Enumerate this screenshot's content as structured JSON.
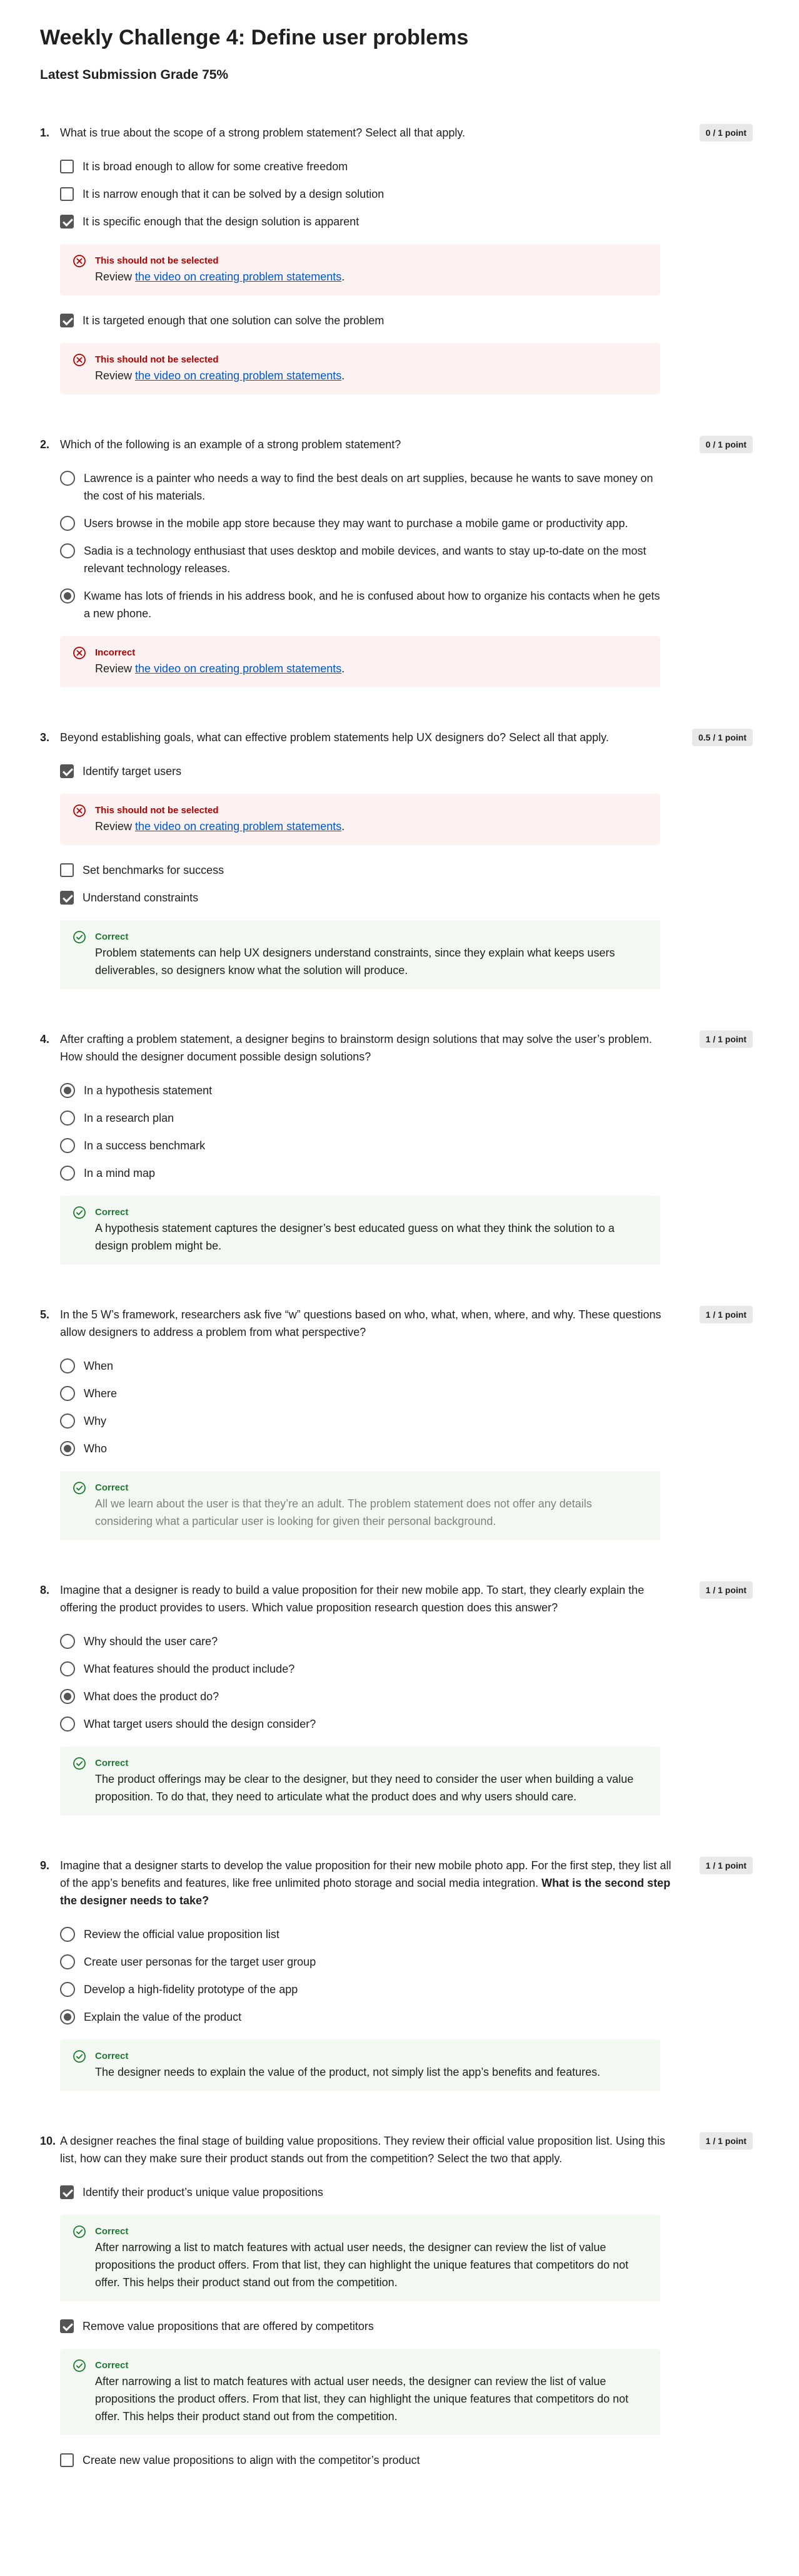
{
  "page": {
    "title": "Weekly Challenge 4: Define user problems",
    "grade": "Latest Submission Grade 75%"
  },
  "feedback_common": {
    "review_prefix": "Review ",
    "review_link": "the video on creating problem statements",
    "review_suffix": "."
  },
  "questions": [
    {
      "number": "1.",
      "text": "What is true about the scope of a strong problem statement? Select all that apply.",
      "points": "0 / 1 point",
      "type": "checkbox",
      "options": [
        {
          "label": "It is broad enough to allow for some creative freedom",
          "checked": false
        },
        {
          "label": "It is narrow enough that it can be solved by a design solution",
          "checked": false
        },
        {
          "label": "It is specific enough that the design solution is apparent",
          "checked": true,
          "feedback": {
            "status": "This should not be selected",
            "kind": "wrong"
          }
        },
        {
          "label": "It is targeted enough that one solution can solve the problem",
          "checked": true,
          "feedback": {
            "status": "This should not be selected",
            "kind": "wrong"
          }
        }
      ]
    },
    {
      "number": "2.",
      "text": "Which of the following is an example of a strong problem statement?",
      "points": "0 / 1 point",
      "type": "radio",
      "options": [
        {
          "label": "Lawrence is a painter who needs a way to find the best deals on art supplies, because he wants to save money on the cost of his materials.",
          "checked": false
        },
        {
          "label": "Users browse in the mobile app store because they may want to purchase a mobile game or productivity app.",
          "checked": false
        },
        {
          "label": "Sadia is a technology enthusiast that uses desktop and mobile devices, and wants to stay up-to-date on the most relevant technology releases.",
          "checked": false
        },
        {
          "label": "Kwame has lots of friends in his address book, and he is confused about how to organize his contacts when he gets a new phone.",
          "checked": true,
          "feedback": {
            "status": "Incorrect",
            "kind": "wrong"
          }
        }
      ]
    },
    {
      "number": "3.",
      "text": "Beyond establishing goals, what can effective problem statements help UX designers do? Select all that apply.",
      "points": "0.5 / 1 point",
      "type": "checkbox",
      "options": [
        {
          "label": "Identify target users",
          "checked": true,
          "feedback": {
            "status": "This should not be selected",
            "kind": "wrong"
          }
        },
        {
          "label": "Set benchmarks for success",
          "checked": false
        },
        {
          "label": "Understand constraints",
          "checked": true,
          "feedback": {
            "status": "Correct",
            "kind": "right",
            "text": "Problem statements can help UX designers understand constraints, since they explain what keeps users deliverables, so designers know what the solution will produce."
          }
        }
      ]
    },
    {
      "number": "4.",
      "text": "After crafting a problem statement, a designer begins to brainstorm design solutions that may solve the user’s problem. How should the designer document possible design solutions?",
      "points": "1 / 1 point",
      "type": "radio",
      "options": [
        {
          "label": "In a hypothesis statement",
          "checked": true
        },
        {
          "label": "In a research plan",
          "checked": false
        },
        {
          "label": "In a success benchmark",
          "checked": false
        },
        {
          "label": "In a mind map",
          "checked": false,
          "feedback": {
            "status": "Correct",
            "kind": "right",
            "text": "A hypothesis statement captures the designer’s best educated guess on what they think the solution to a design problem might be."
          }
        }
      ]
    },
    {
      "number": "5.",
      "text": "In the 5 W’s framework, researchers ask five “w” questions based on who, what, when, where, and why. These questions allow designers to address a problem from what perspective?",
      "points": "1 / 1 point",
      "type": "radio",
      "options": [
        {
          "label": "When",
          "checked": false
        },
        {
          "label": "Where",
          "checked": false
        },
        {
          "label": "Why",
          "checked": false
        },
        {
          "label": "Who",
          "checked": true,
          "feedback": {
            "status": "Correct",
            "kind": "right",
            "text": "All we learn about the user is that they’re an adult. The problem statement does not offer any details considering what a particular user is looking for given their personal background.",
            "blur": true
          }
        }
      ]
    },
    {
      "number": "8.",
      "text": "Imagine that a designer is ready to build a value proposition for their new mobile app. To start, they clearly explain the offering the product provides to users. Which value proposition research question does this answer?",
      "points": "1 / 1 point",
      "type": "radio",
      "options": [
        {
          "label": "Why should the user care?",
          "checked": false
        },
        {
          "label": "What features should the product include?",
          "checked": false
        },
        {
          "label": "What does the product do?",
          "checked": true
        },
        {
          "label": "What target users should the design consider?",
          "checked": false,
          "feedback": {
            "status": "Correct",
            "kind": "right",
            "text": "The product offerings may be clear to the designer, but they need to consider the user when building a value proposition. To do that, they need to articulate what the product does and why users should care."
          }
        }
      ]
    },
    {
      "number": "9.",
      "text": "Imagine that a designer starts to develop the value proposition for their new mobile photo app. For the first step, they list all of the app’s benefits and features, like free unlimited photo storage and social media integration.",
      "text_bold": " What is the second step the designer needs to take?",
      "points": "1 / 1 point",
      "type": "radio",
      "options": [
        {
          "label": "Review the official value proposition list",
          "checked": false
        },
        {
          "label": "Create user personas for the target user group",
          "checked": false
        },
        {
          "label": "Develop a high-fidelity prototype of the app",
          "checked": false
        },
        {
          "label": "Explain the value of the product",
          "checked": true,
          "feedback": {
            "status": "Correct",
            "kind": "right",
            "text": "The designer needs to explain the value of the product, not simply list the app’s benefits and features."
          }
        }
      ]
    },
    {
      "number": "10.",
      "text": "A designer reaches the final stage of building value propositions. They review their official value proposition list. Using this list, how can they make sure their product stands out from the competition? Select the two that apply.",
      "points": "1 / 1 point",
      "type": "checkbox",
      "options": [
        {
          "label": "Identify their product’s unique value propositions",
          "checked": true,
          "feedback": {
            "status": "Correct",
            "kind": "right",
            "text": "After narrowing a list to match features with actual user needs, the designer can review the list of value propositions the product offers. From that list, they can highlight the unique features that competitors do not offer. This helps their product stand out from the competition."
          }
        },
        {
          "label": "Remove value propositions that are offered by competitors",
          "checked": true,
          "feedback": {
            "status": "Correct",
            "kind": "right",
            "text": "After narrowing a list to match features with actual user needs, the designer can review the list of value propositions the product offers. From that list, they can highlight the unique features that competitors do not offer. This helps their product stand out from the competition."
          }
        },
        {
          "label": "Create new value propositions to align with the competitor’s product",
          "checked": false
        }
      ]
    }
  ],
  "colors": {
    "wrong_bg": "#fdf2f2",
    "wrong_text": "#b30000",
    "right_bg": "#f3f8f3",
    "right_text": "#1e7a32",
    "link": "#0056d2"
  },
  "icons": {
    "wrong": "x-circle-icon",
    "right": "check-circle-icon"
  }
}
